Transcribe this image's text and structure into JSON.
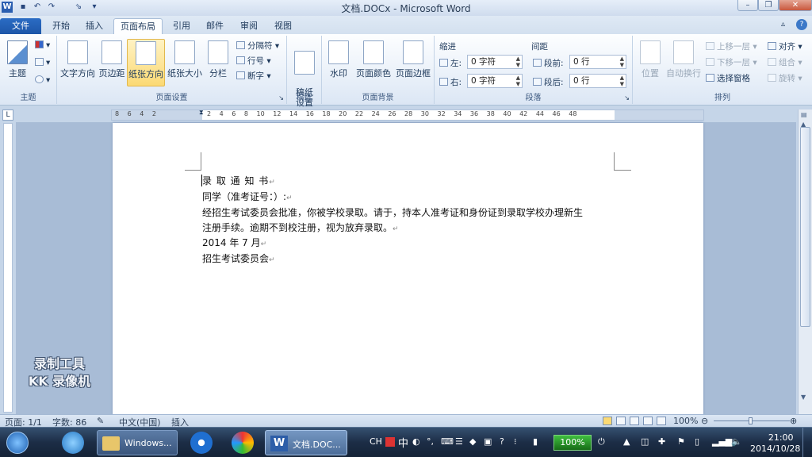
{
  "window": {
    "title": "文档.DOCx - Microsoft Word"
  },
  "tabs": [
    "文件",
    "开始",
    "插入",
    "页面布局",
    "引用",
    "邮件",
    "审阅",
    "视图"
  ],
  "ribbon": {
    "theme": {
      "btn": "主题",
      "group": "主题"
    },
    "page_setup": {
      "text_direction": "文字方向",
      "margins": "页边距",
      "orientation": "纸张方向",
      "size": "纸张大小",
      "columns": "分栏",
      "breaks": "分隔符",
      "line_numbers": "行号",
      "hyphenation": "断字",
      "group": "页面设置"
    },
    "draft": {
      "btn": "稿纸\n设置",
      "group": "稿纸"
    },
    "background": {
      "watermark": "水印",
      "page_color": "页面颜色",
      "page_border": "页面边框",
      "group": "页面背景"
    },
    "paragraph": {
      "indent": "缩进",
      "spacing": "间距",
      "left_label": "左:",
      "left_value": "0 字符",
      "right_label": "右:",
      "right_value": "0 字符",
      "before_label": "段前:",
      "before_value": "0 行",
      "after_label": "段后:",
      "after_value": "0 行",
      "group": "段落"
    },
    "arrange": {
      "position": "位置",
      "wrap": "自动换行",
      "bring_forward": "上移一层",
      "send_backward": "下移一层",
      "selection_pane": "选择窗格",
      "align": "对齐",
      "group_btn": "组合",
      "rotate": "旋转",
      "group": "排列"
    }
  },
  "ruler": {
    "left": "8 6 4 2",
    "marks": "2 4 6 8 10 12 14 16 18 20 22 24 26 28 30 32 34 36 38 40 42 44 46 48"
  },
  "document": {
    "lines": [
      "录 取 通 知 书",
      "同学（准考证号：）:",
      "经招生考试委员会批准，你被学校录取。请于，持本人准考证和身份证到录取学校办理新生",
      "注册手续。逾期不到校注册，视为放弃录取。",
      "2014 年 7 月",
      "招生考试委员会"
    ]
  },
  "watermark": {
    "line1": "录制工具",
    "line2": "KK 录像机"
  },
  "status": {
    "page": "页面: 1/1",
    "words": "字数: 86",
    "language": "中文(中国)",
    "mode": "插入",
    "zoom": "100%"
  },
  "taskbar": {
    "windows_label": "Windows...",
    "word_label": "文档.DOC...",
    "ime": "CH",
    "ime_mode": "中",
    "battery": "100%",
    "time": "21:00",
    "date": "2014/10/28"
  }
}
